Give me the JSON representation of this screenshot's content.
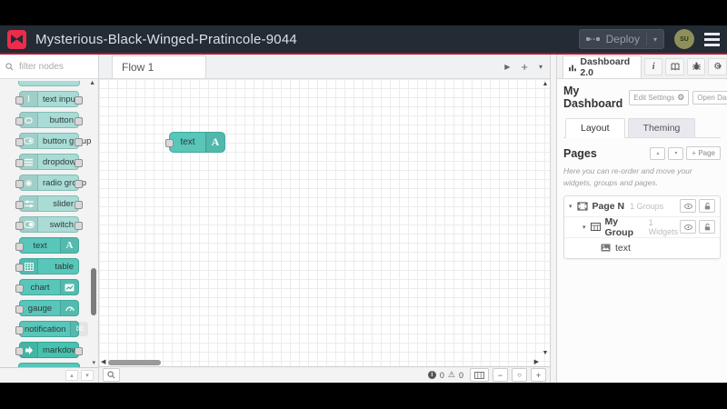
{
  "header": {
    "title": "Mysterious-Black-Winged-Pratincole-9044",
    "deploy": {
      "label": "Deploy"
    },
    "avatar": {
      "initials": "SU"
    }
  },
  "palette": {
    "filter": {
      "placeholder": "filter nodes"
    },
    "nodes": [
      {
        "label": "text input"
      },
      {
        "label": "button"
      },
      {
        "label": "button group"
      },
      {
        "label": "dropdown"
      },
      {
        "label": "radio group"
      },
      {
        "label": "slider"
      },
      {
        "label": "switch"
      },
      {
        "label": "text"
      },
      {
        "label": "table"
      },
      {
        "label": "chart"
      },
      {
        "label": "gauge"
      },
      {
        "label": "notification"
      },
      {
        "label": "markdown"
      }
    ]
  },
  "workspace": {
    "tab": {
      "label": "Flow 1"
    },
    "canvas_node": {
      "label": "text",
      "icon_letter": "A"
    },
    "footer": {
      "info_count": "0",
      "warning_count": "0"
    }
  },
  "sidebar": {
    "tab": {
      "label": "Dashboard 2.0"
    },
    "dashboard": {
      "name": "My Dashboard",
      "edit_settings": "Edit Settings",
      "open_dashboard": "Open Dashboard"
    },
    "tabs": {
      "layout": "Layout",
      "theming": "Theming"
    },
    "pages": {
      "heading": "Pages",
      "add_page": "+ Page",
      "description": "Here you can re-order and move your widgets, groups and pages."
    },
    "tree": {
      "page": {
        "label": "Page N",
        "meta": "1 Groups"
      },
      "group": {
        "label": "My Group",
        "meta": "1 Widgets"
      },
      "widget": {
        "label": "text"
      }
    }
  },
  "icons": {
    "caret_down": "▾",
    "caret_up": "▴",
    "tri_up": "▲",
    "tri_down": "▼",
    "tri_left": "◀",
    "tri_right": "▶",
    "play": "▶",
    "plus": "+",
    "minus": "−",
    "circle": "○",
    "warning": "⚠",
    "gear": "⚙",
    "external": "↗",
    "info_i": "i",
    "envelope": "✉",
    "radio": "◉",
    "ibeam": "I",
    "letter_a": "A",
    "chevron": "v"
  }
}
